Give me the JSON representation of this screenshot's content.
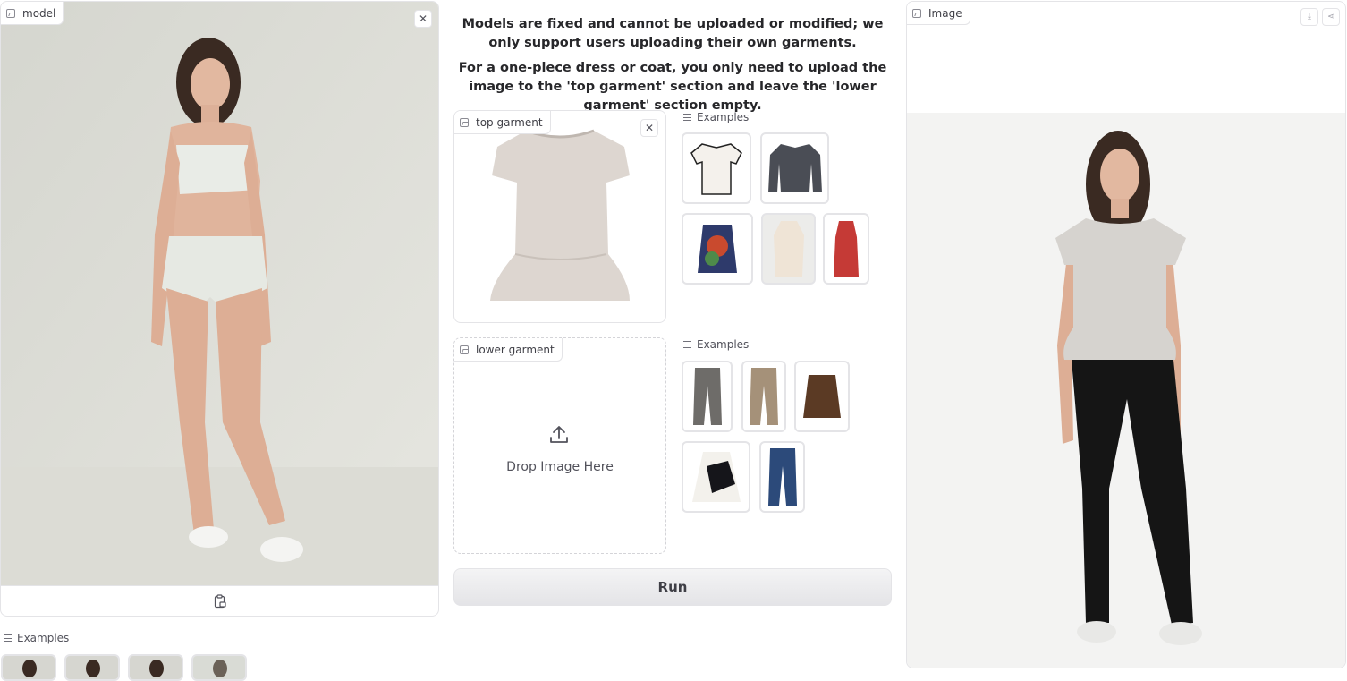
{
  "model_panel": {
    "label": "model",
    "close_icon": "close-icon",
    "paste_icon": "clipboard-image-icon"
  },
  "notice": {
    "line1": "Models are fixed and cannot be uploaded or modified; we only support users uploading their own garments.",
    "line2": "For a one-piece dress or coat, you only need to upload the image to the 'top garment' section and leave the 'lower garment' section empty."
  },
  "top_garment": {
    "label": "top garment"
  },
  "lower_garment": {
    "label": "lower garment",
    "drop_text": "Drop Image Here"
  },
  "top_examples": {
    "label": "Examples"
  },
  "lower_examples": {
    "label": "Examples"
  },
  "model_examples": {
    "label": "Examples"
  },
  "run": {
    "label": "Run"
  },
  "output": {
    "label": "Image",
    "download_icon": "download-icon",
    "share_icon": "share-icon"
  },
  "colors": {
    "accent": "#27272a",
    "border": "#e4e4e7",
    "background": "#ffffff"
  }
}
